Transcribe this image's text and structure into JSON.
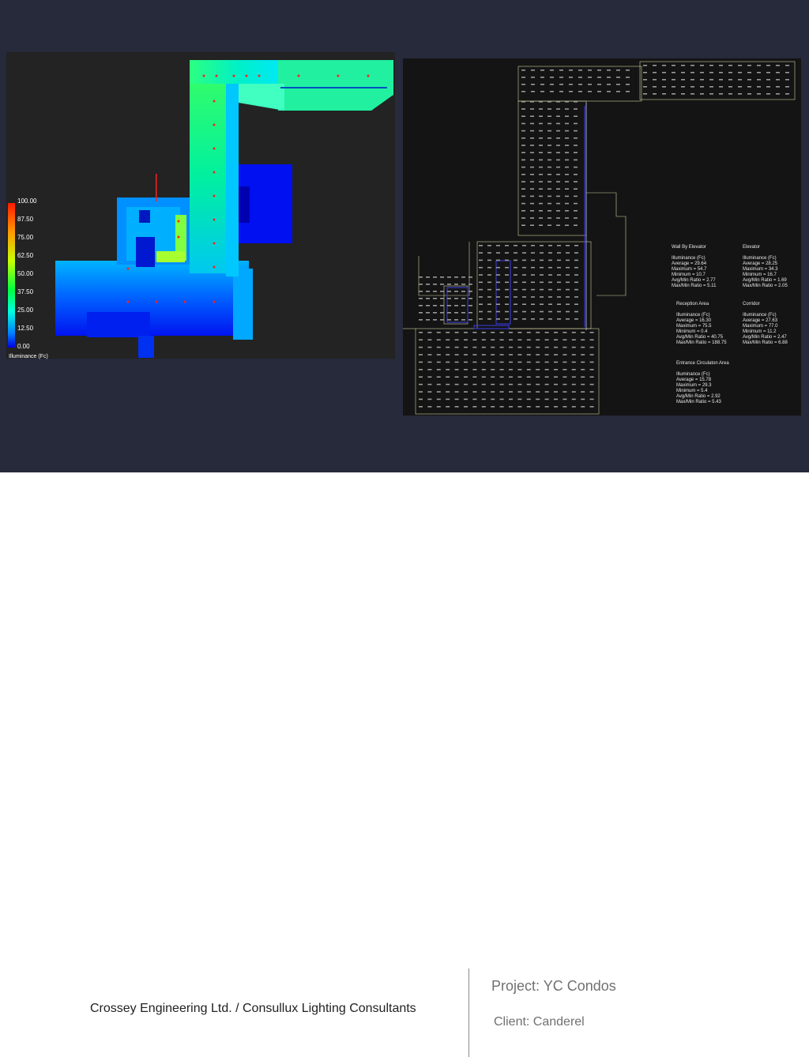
{
  "legend": {
    "ticks": [
      "100.00",
      "87.50",
      "75.00",
      "62.50",
      "50.00",
      "37.50",
      "25.00",
      "12.50",
      "0.00"
    ],
    "label": "Illuminance (Fc)"
  },
  "areas": [
    {
      "title": "Wall By Elevator",
      "lines": [
        "Illuminance (Fc)",
        "Average = 29.64",
        "Maximum = 54.7",
        "Minimum = 10.7",
        "Avg/Min Ratio = 2.77",
        "Max/Min Ratio = 5.11"
      ]
    },
    {
      "title": "Elevator",
      "lines": [
        "Illuminance (Fc)",
        "Average = 28.25",
        "Maximum = 34.3",
        "Minimum = 16.7",
        "Avg/Min Ratio = 1.69",
        "Max/Min Ratio = 2.05"
      ]
    },
    {
      "title": "Reception Area",
      "lines": [
        "Illuminance (Fc)",
        "Average = 16.30",
        "Maximum = 75.5",
        "Minimum = 0.4",
        "Avg/Min Ratio = 40.75",
        "Max/Min Ratio = 188.75"
      ]
    },
    {
      "title": "Corridor",
      "lines": [
        "Illuminance (Fc)",
        "Average = 27.63",
        "Maximum = 77.0",
        "Minimum = 11.2",
        "Avg/Min Ratio = 2.47",
        "Max/Min Ratio = 6.88"
      ]
    },
    {
      "title": "Entrance Circulaton Area",
      "lines": [
        "Illuminance (Fc)",
        "Average = 15.78",
        "Maximum = 29.3",
        "Minimum = 5.4",
        "Avg/Min Ratio = 2.92",
        "Max/Min Ratio = 5.43"
      ]
    }
  ],
  "footer": {
    "company": "Crossey Engineering Ltd. / Consullux Lighting Consultants",
    "project": "Project: YC Condos",
    "client": "Client: Canderel"
  },
  "colors": {
    "background": "#262a3a",
    "render_bg": "#232323",
    "plan_bg": "#141414"
  }
}
